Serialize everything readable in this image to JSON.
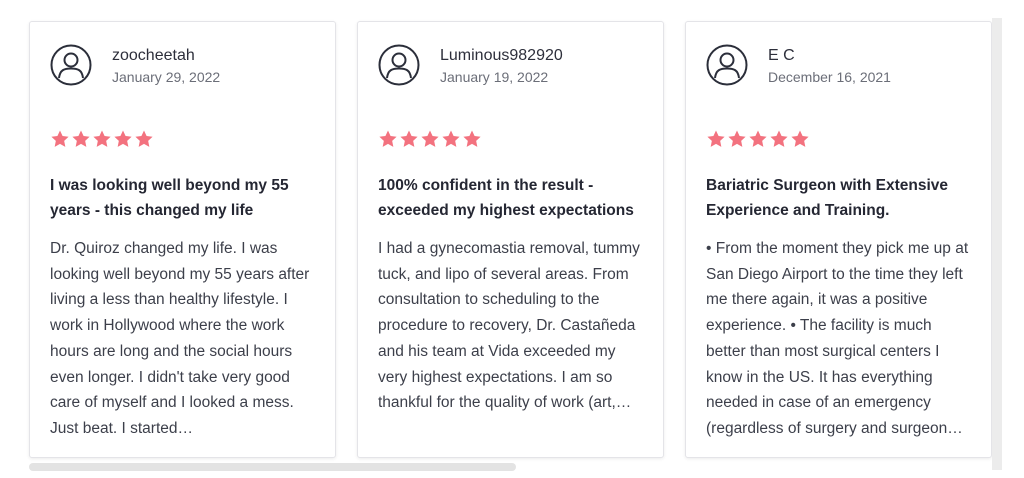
{
  "colors": {
    "star": "#f3727f",
    "card_border": "#e4e4e8",
    "text": "#2b2e3a",
    "muted": "#6b6e78"
  },
  "rating_max": 5,
  "reviews": [
    {
      "author": "zoocheetah",
      "date": "January 29, 2022",
      "rating": 5,
      "title": "I was looking well beyond my 55 years - this changed my life",
      "body": "Dr. Quiroz changed my life. I was looking well beyond my 55 years after living a less than healthy lifestyle. I work in Hollywood where the work hours are long and the social hours even longer. I didn't take very good care of myself and I looked a mess. Just beat. I started…"
    },
    {
      "author": "Luminous982920",
      "date": "January 19, 2022",
      "rating": 5,
      "title": "100% confident in the result - exceeded my highest expectations",
      "body": "I had a gynecomastia removal, tummy tuck, and lipo of several areas. From consultation to scheduling to the procedure to recovery, Dr. Castañeda and his team at Vida exceeded my very highest expectations. I am so thankful for the quality of work (art,…"
    },
    {
      "author": "E C",
      "date": "December 16, 2021",
      "rating": 5,
      "title": "Bariatric Surgeon with Extensive Experience and Training.",
      "body": "• From the moment they pick me up at San Diego Airport to the time they left me there again, it was a positive experience. • The facility is much better than most surgical centers I know in the US. It has everything needed in case of an emergency (regardless of surgery and surgeon…"
    }
  ]
}
